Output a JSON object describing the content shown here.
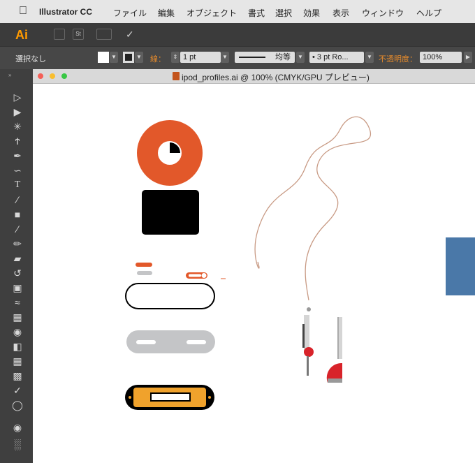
{
  "menubar": {
    "app_name": "Illustrator CC",
    "items": [
      "ファイル",
      "編集",
      "オブジェクト",
      "書式",
      "選択",
      "効果",
      "表示",
      "ウィンドウ",
      "ヘルプ"
    ]
  },
  "appbar": {
    "logo": "Ai",
    "icons": [
      "bridge-icon",
      "stock-icon",
      "arrange-documents-icon",
      "gpu-performance-icon"
    ]
  },
  "control": {
    "selection_label": "選択なし",
    "stroke_label": "線：",
    "stroke_weight": "1 pt",
    "profile_label": "均等",
    "brush_label": "3 pt Ro...",
    "opacity_label": "不透明度：",
    "opacity_value": "100%"
  },
  "document": {
    "title": "ipod_profiles.ai @ 100% (CMYK/GPU プレビュー)"
  },
  "tools": [
    "selection-tool-icon",
    "direct-selection-tool-icon",
    "magic-wand-tool-icon",
    "lasso-tool-icon",
    "pen-tool-icon",
    "curvature-tool-icon",
    "type-tool-icon",
    "line-tool-icon",
    "rectangle-tool-icon",
    "paintbrush-tool-icon",
    "pencil-tool-icon",
    "eraser-tool-icon",
    "rotate-tool-icon",
    "scale-tool-icon",
    "width-tool-icon",
    "free-transform-tool-icon",
    "shape-builder-tool-icon",
    "perspective-grid-tool-icon",
    "mesh-tool-icon",
    "gradient-tool-icon",
    "eyedropper-tool-icon",
    "blend-tool-icon",
    "symbol-sprayer-tool-icon",
    "column-graph-tool-icon"
  ],
  "colors": {
    "accent_orange": "#e2582a",
    "dark": "#000000",
    "gray": "#c4c5c7",
    "amber": "#f0a22c",
    "red": "#d8232a",
    "blue_panel": "#4a78a8"
  }
}
